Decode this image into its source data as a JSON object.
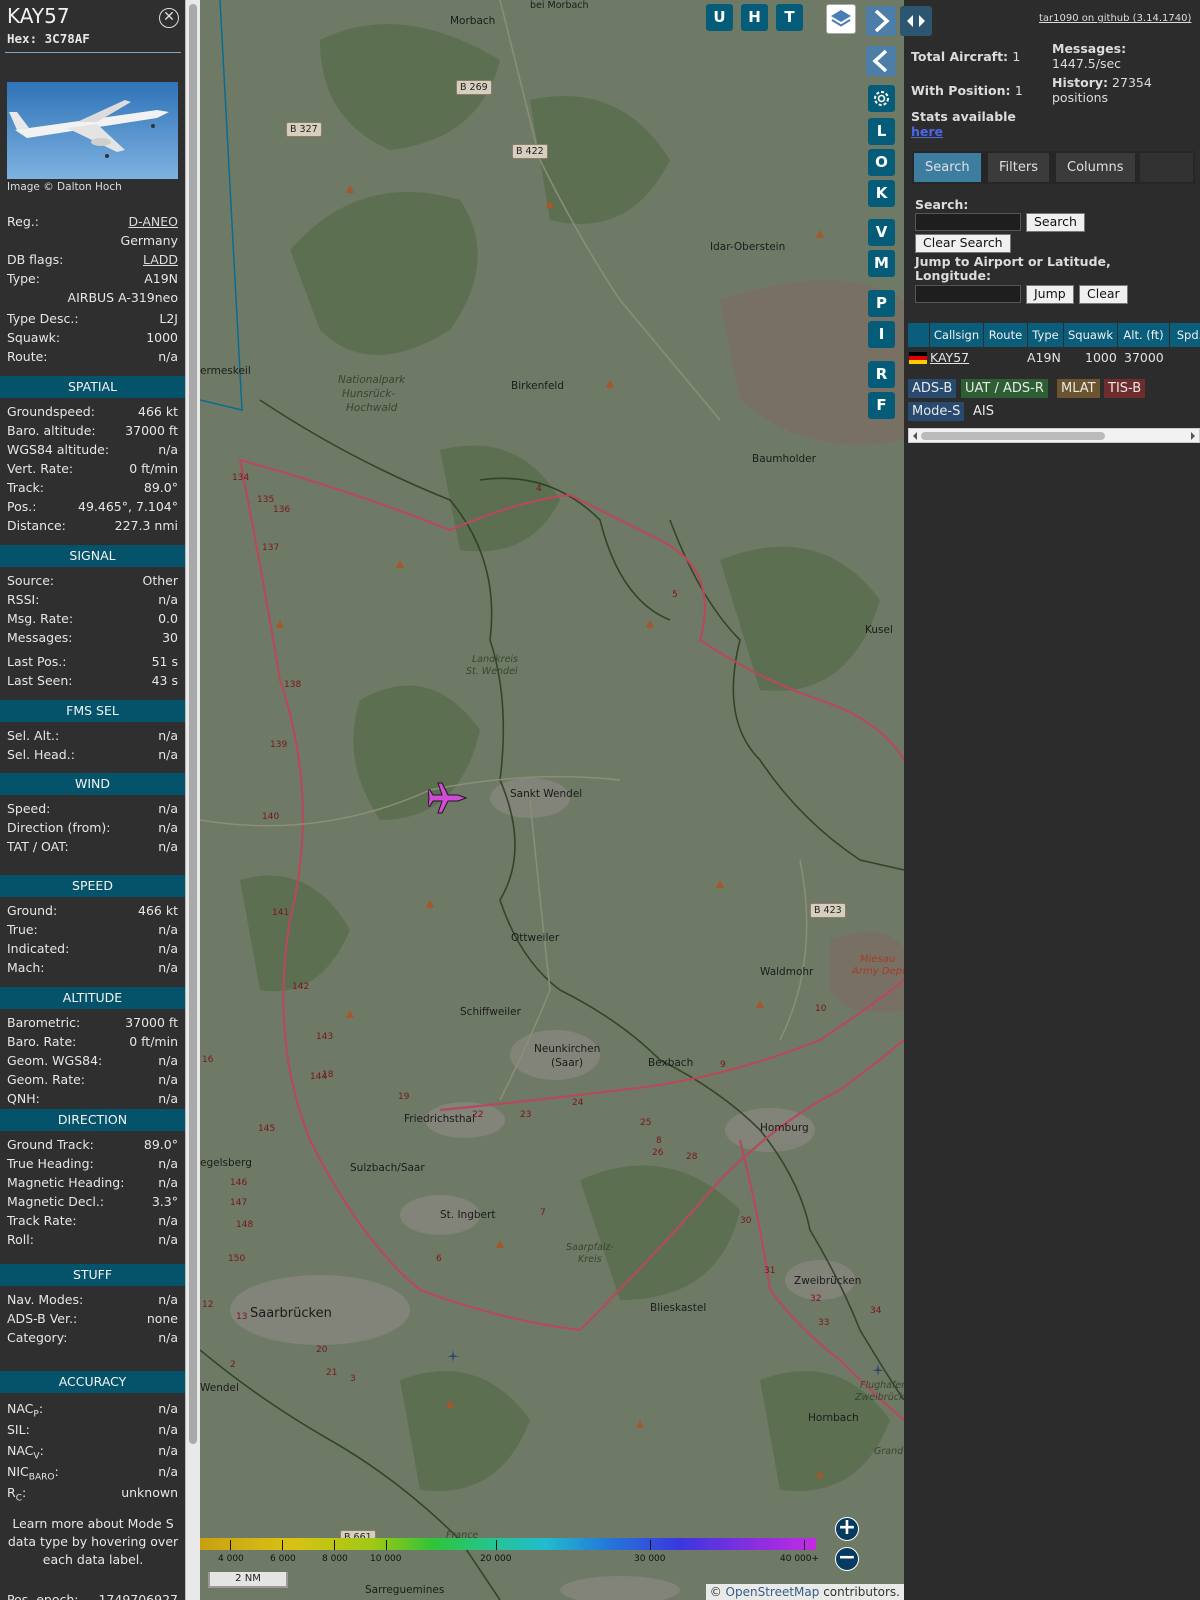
{
  "aircraft": {
    "callsign": "KAY57",
    "hex_label": "Hex:",
    "hex": "3C78AF",
    "photo_credit": "Image © Dalton Hoch"
  },
  "details": [
    {
      "label": "Reg.:",
      "value": "D-ANEO",
      "link": true
    },
    {
      "label": "",
      "value": "Germany"
    },
    {
      "label": "DB flags:",
      "value": "LADD",
      "link": true
    },
    {
      "label": "Type:",
      "value": "A19N"
    },
    {
      "label": "",
      "value": "AIRBUS A-319neo"
    },
    {
      "label": "Type Desc.:",
      "value": "L2J"
    },
    {
      "label": "Squawk:",
      "value": "1000"
    },
    {
      "label": "Route:",
      "value": "n/a"
    }
  ],
  "sections": [
    {
      "title": "SPATIAL",
      "rows": [
        {
          "label": "Groundspeed:",
          "value": "466 kt"
        },
        {
          "label": "Baro. altitude:",
          "value": "37000 ft"
        },
        {
          "label": "WGS84 altitude:",
          "value": "n/a"
        },
        {
          "label": "Vert. Rate:",
          "value": "0 ft/min"
        },
        {
          "label": "Track:",
          "value": "89.0°"
        },
        {
          "label": "Pos.:",
          "value": "49.465°, 7.104°"
        },
        {
          "label": "Distance:",
          "value": "227.3 nmi"
        }
      ]
    },
    {
      "title": "SIGNAL",
      "rows": [
        {
          "label": "Source:",
          "value": "Other"
        },
        {
          "label": "RSSI:",
          "value": "n/a"
        },
        {
          "label": "Msg. Rate:",
          "value": "0.0"
        },
        {
          "label": "Messages:",
          "value": "30"
        },
        {
          "label": "Last Pos.:",
          "value": "51 s"
        },
        {
          "label": "Last Seen:",
          "value": "43 s"
        }
      ]
    },
    {
      "title": "FMS SEL",
      "rows": [
        {
          "label": "Sel. Alt.:",
          "value": "n/a"
        },
        {
          "label": "Sel. Head.:",
          "value": "n/a"
        }
      ]
    },
    {
      "title": "WIND",
      "rows": [
        {
          "label": "Speed:",
          "value": "n/a"
        },
        {
          "label": "Direction (from):",
          "value": "n/a"
        },
        {
          "label": "TAT / OAT:",
          "value": "n/a"
        }
      ]
    },
    {
      "title": "SPEED",
      "rows": [
        {
          "label": "Ground:",
          "value": "466 kt"
        },
        {
          "label": "True:",
          "value": "n/a"
        },
        {
          "label": "Indicated:",
          "value": "n/a"
        },
        {
          "label": "Mach:",
          "value": "n/a"
        }
      ]
    },
    {
      "title": "ALTITUDE",
      "rows": [
        {
          "label": "Barometric:",
          "value": "37000 ft"
        },
        {
          "label": "Baro. Rate:",
          "value": "0 ft/min"
        },
        {
          "label": "Geom. WGS84:",
          "value": "n/a"
        },
        {
          "label": "Geom. Rate:",
          "value": "n/a"
        },
        {
          "label": "QNH:",
          "value": "n/a"
        }
      ]
    },
    {
      "title": "DIRECTION",
      "rows": [
        {
          "label": "Ground Track:",
          "value": "89.0°"
        },
        {
          "label": "True Heading:",
          "value": "n/a"
        },
        {
          "label": "Magnetic Heading:",
          "value": "n/a"
        },
        {
          "label": "Magnetic Decl.:",
          "value": "3.3°"
        },
        {
          "label": "Track Rate:",
          "value": "n/a"
        },
        {
          "label": "Roll:",
          "value": "n/a"
        }
      ]
    },
    {
      "title": "STUFF",
      "rows": [
        {
          "label": "Nav. Modes:",
          "value": "n/a"
        },
        {
          "label": "ADS-B Ver.:",
          "value": "none"
        },
        {
          "label": "Category:",
          "value": "n/a"
        }
      ]
    },
    {
      "title": "ACCURACY",
      "rows": [
        {
          "label": "NACP:",
          "value": "n/a"
        },
        {
          "label": "SIL:",
          "value": "n/a"
        },
        {
          "label": "NACV:",
          "value": "n/a"
        },
        {
          "label": "NICBARO:",
          "value": "n/a"
        },
        {
          "label": "RC:",
          "value": "unknown"
        }
      ]
    }
  ],
  "accuracy_labels": {
    "nacp_main": "NAC",
    "nacp_sub": "P",
    "nacv_main": "NAC",
    "nacv_sub": "V",
    "nicbaro_main": "NIC",
    "nicbaro_sub": "BARO",
    "rc_main": "R",
    "rc_sub": "C"
  },
  "help_note": "Learn more about Mode S data type by hovering over each data label.",
  "pos_epoch": {
    "label": "Pos. epoch:",
    "value": "1749706927"
  },
  "map": {
    "top_buttons": [
      "U",
      "H",
      "T"
    ],
    "side_buttons": [
      "L",
      "O",
      "K",
      "V",
      "M",
      "P",
      "I",
      "R",
      "F"
    ],
    "places": [
      {
        "name": "Morbach"
      },
      {
        "name": "bei Morbach"
      },
      {
        "name": "Idar-Oberstein"
      },
      {
        "name": "Birkenfeld"
      },
      {
        "name": "Baumholder"
      },
      {
        "name": "Kusel"
      },
      {
        "name": "Sankt Wendel"
      },
      {
        "name": "Ottweiler"
      },
      {
        "name": "Waldmohr"
      },
      {
        "name": "Schiffweiler"
      },
      {
        "name": "Neunkirchen"
      },
      {
        "name": "(Saar)"
      },
      {
        "name": "Bexbach"
      },
      {
        "name": "Friedrichsthal"
      },
      {
        "name": "Homburg"
      },
      {
        "name": "Sulzbach/Saar"
      },
      {
        "name": "St. Ingbert"
      },
      {
        "name": "Zweibrücken"
      },
      {
        "name": "Saarbrücken"
      },
      {
        "name": "Blieskastel"
      },
      {
        "name": "Hornbach"
      },
      {
        "name": "Sarreguemines"
      },
      {
        "name": "ermeskeil"
      },
      {
        "name": "egelsberg"
      },
      {
        "name": "Wendel"
      },
      {
        "name": "Flughafen"
      },
      {
        "name": "Zweibrücken"
      }
    ],
    "regions": [
      {
        "name": "Nationalpark"
      },
      {
        "name": "Hunsrück-"
      },
      {
        "name": "Hochwald"
      },
      {
        "name": "Landkreis"
      },
      {
        "name": "St. Wendel"
      },
      {
        "name": "Saarpfalz-"
      },
      {
        "name": "Kreis"
      },
      {
        "name": "Miesau"
      },
      {
        "name": "Army Depo"
      },
      {
        "name": "France"
      },
      {
        "name": "Grand"
      }
    ],
    "roads": [
      "B 269",
      "B 327",
      "B 422",
      "B 423",
      "B 661"
    ],
    "road_numbers": [
      "134",
      "135",
      "136",
      "137",
      "138",
      "139",
      "140",
      "141",
      "142",
      "143",
      "144",
      "145",
      "146",
      "147",
      "148",
      "150",
      "12",
      "13",
      "2",
      "3",
      "4",
      "5",
      "6",
      "7",
      "8",
      "9",
      "10",
      "18",
      "19",
      "20",
      "21",
      "22",
      "23",
      "24",
      "25",
      "26",
      "28",
      "30",
      "31",
      "32",
      "33",
      "34",
      "16"
    ],
    "altitude_scale": [
      "4 000",
      "6 000",
      "8 000",
      "10 000",
      "20 000",
      "30 000",
      "40 000+"
    ],
    "scale_label": "2 NM",
    "attribution_prefix": "© ",
    "attribution_link": "OpenStreetMap",
    "attribution_suffix": " contributors."
  },
  "side": {
    "github": "tar1090 on github (3.14.1740)",
    "total_aircraft_label": "Total Aircraft:",
    "total_aircraft": "1",
    "with_position_label": "With Position:",
    "with_position": "1",
    "messages_label": "Messages:",
    "messages": "1447.5/sec",
    "history_label": "History:",
    "history": "27354",
    "history_unit": "positions",
    "stats_label": "Stats available",
    "stats_link": "here",
    "tabs": [
      "Search",
      "Filters",
      "Columns"
    ],
    "search_label": "Search:",
    "search_button": "Search",
    "clear_search_button": "Clear Search",
    "jump_label": "Jump to Airport or Latitude, Longitude:",
    "jump_button": "Jump",
    "clear_button": "Clear",
    "columns": [
      "Callsign",
      "Route",
      "Type",
      "Squawk",
      "Alt. (ft)",
      "Spd."
    ],
    "rows": [
      {
        "callsign": "KAY57",
        "route": "",
        "type": "A19N",
        "squawk": "1000",
        "alt": "37000"
      }
    ],
    "badges": [
      "ADS-B",
      "UAT / ADS-R",
      "MLAT",
      "TIS-B",
      "Mode-S",
      "AIS"
    ],
    "badge_colors": [
      "#284a6e",
      "#2e5e33",
      "#6b5430",
      "#6e2c2c",
      "#284a6e",
      "#2c2c2c"
    ]
  }
}
